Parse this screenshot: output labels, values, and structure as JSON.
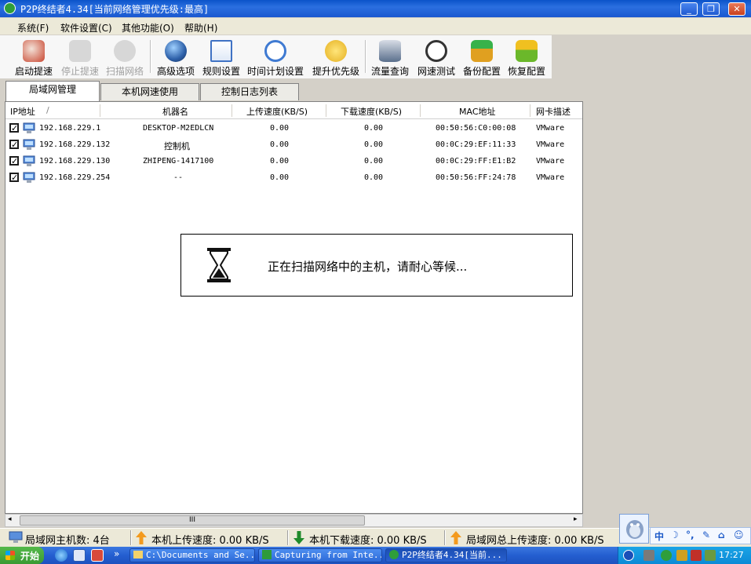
{
  "window": {
    "title": "P2P终结者4.34[当前网络管理优先级:最高]"
  },
  "menu": [
    "系统(F)",
    "软件设置(C)",
    "其他功能(O)",
    "帮助(H)"
  ],
  "toolbar": [
    {
      "label": "启动提速",
      "icon": "rocket-icon",
      "color": "#c8452f",
      "enabled": true
    },
    {
      "label": "停止提速",
      "icon": "stop-icon",
      "color": "#9a9a9a",
      "enabled": false
    },
    {
      "label": "扫描网络",
      "icon": "magnifier-icon",
      "color": "#9a9a9a",
      "enabled": false
    },
    {
      "label": "高级选项",
      "icon": "globe-icon",
      "color": "#2c5fa8",
      "enabled": true
    },
    {
      "label": "规则设置",
      "icon": "rules-icon",
      "color": "#d9a43a",
      "enabled": true
    },
    {
      "label": "时间计划设置",
      "icon": "clock-icon",
      "color": "#3f7ad2",
      "enabled": true
    },
    {
      "label": "提升优先级",
      "icon": "medal-icon",
      "color": "#e5b020",
      "enabled": true
    },
    {
      "label": "流量查询",
      "icon": "database-icon",
      "color": "#5a6f8c",
      "enabled": true
    },
    {
      "label": "网速测试",
      "icon": "speedometer-icon",
      "color": "#333333",
      "enabled": true
    },
    {
      "label": "备份配置",
      "icon": "backup-icon",
      "color": "#e0a020",
      "enabled": true
    },
    {
      "label": "恢复配置",
      "icon": "restore-icon",
      "color": "#6bb82a",
      "enabled": true
    }
  ],
  "tabs": [
    "局域网管理",
    "本机网速使用",
    "控制日志列表"
  ],
  "columns": [
    "IP地址",
    "机器名",
    "上传速度(KB/S)",
    "下载速度(KB/S)",
    "MAC地址",
    "网卡描述"
  ],
  "sort_indicator": "/",
  "rows": [
    {
      "ip": "192.168.229.1",
      "name": "DESKTOP-M2EDLCN",
      "up": "0.00",
      "down": "0.00",
      "mac": "00:50:56:C0:00:08",
      "desc": "VMware"
    },
    {
      "ip": "192.168.229.132",
      "name": "控制机",
      "up": "0.00",
      "down": "0.00",
      "mac": "00:0C:29:EF:11:33",
      "desc": "VMware"
    },
    {
      "ip": "192.168.229.130",
      "name": "ZHIPENG-1417100",
      "up": "0.00",
      "down": "0.00",
      "mac": "00:0C:29:FF:E1:B2",
      "desc": "VMware"
    },
    {
      "ip": "192.168.229.254",
      "name": "--",
      "up": "0.00",
      "down": "0.00",
      "mac": "00:50:56:FF:24:78",
      "desc": "VMware"
    }
  ],
  "dialog": {
    "message": "正在扫描网络中的主机，请耐心等候..."
  },
  "scrollbar": {
    "thumb_grip": "III"
  },
  "status": {
    "host_count": "局域网主机数:  4台",
    "upload": "本机上传速度:  0.00 KB/S",
    "download": "本机下载速度:  0.00 KB/S",
    "lan_upload": "局域网总上传速度:  0.00 KB/S"
  },
  "ime": [
    "中",
    "☽",
    "°,",
    "✎",
    "⌂",
    "☺"
  ],
  "taskbar": {
    "start": "开始",
    "quick_launch": [
      "ie-icon",
      "browser-icon",
      "media-icon"
    ],
    "overflow": "»",
    "items": [
      "C:\\Documents and Se...",
      "Capturing from Inte...",
      "P2P终结者4.34[当前..."
    ],
    "clock": "17:27"
  }
}
